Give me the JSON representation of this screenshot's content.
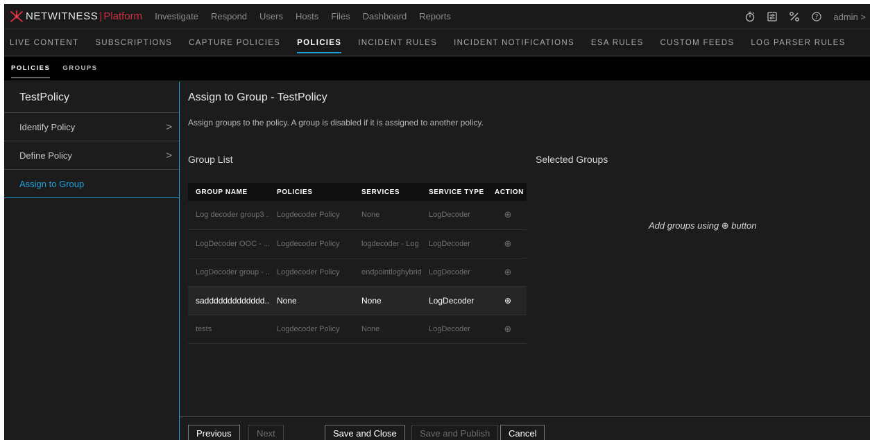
{
  "topnav": {
    "brand": "NETWITNESS",
    "brand_sep": "|",
    "platform": "Platform",
    "links": [
      "Investigate",
      "Respond",
      "Users",
      "Hosts",
      "Files",
      "Dashboard",
      "Reports"
    ],
    "icons": [
      "stopwatch-icon",
      "list-settings-icon",
      "tools-icon",
      "help-icon"
    ],
    "admin": "admin >"
  },
  "config_tabs": [
    "LIVE CONTENT",
    "SUBSCRIPTIONS",
    "CAPTURE POLICIES",
    "POLICIES",
    "INCIDENT RULES",
    "INCIDENT NOTIFICATIONS",
    "ESA RULES",
    "CUSTOM FEEDS",
    "LOG PARSER RULES"
  ],
  "config_active": "POLICIES",
  "sub_tabs": [
    "POLICIES",
    "GROUPS"
  ],
  "sub_active": "POLICIES",
  "left": {
    "title": "TestPolicy",
    "steps": [
      {
        "label": "Identify Policy",
        "chevron": ">"
      },
      {
        "label": "Define Policy",
        "chevron": ">"
      },
      {
        "label": "Assign to Group",
        "chevron": ""
      }
    ]
  },
  "main": {
    "heading": "Assign to Group - TestPolicy",
    "description": "Assign groups to the policy. A group is disabled if it is assigned to another policy.",
    "group_list_title": "Group List",
    "selected_title": "Selected Groups",
    "empty_message": "Add groups using ⊕ button",
    "table": {
      "columns": [
        "GROUP NAME",
        "POLICIES",
        "SERVICES",
        "SERVICE TYPE",
        "ACTION"
      ],
      "rows": [
        {
          "name": "Log decoder group3 ...",
          "policies": "Logdecoder Policy",
          "services": "None",
          "type": "LogDecoder",
          "action": "⊕",
          "enabled": false
        },
        {
          "name": "LogDecoder OOC - ...",
          "policies": "Logdecoder Policy",
          "services": "logdecoder - Log D",
          "type": "LogDecoder",
          "action": "⊕",
          "enabled": false
        },
        {
          "name": "LogDecoder group - ...",
          "policies": "Logdecoder Policy",
          "services": "endpointloghybrid",
          "type": "LogDecoder",
          "action": "⊕",
          "enabled": false
        },
        {
          "name": "saddddddddddddd...",
          "policies": "None",
          "services": "None",
          "type": "LogDecoder",
          "action": "⊕",
          "enabled": true
        },
        {
          "name": "tests",
          "policies": "Logdecoder Policy",
          "services": "None",
          "type": "LogDecoder",
          "action": "⊕",
          "enabled": false
        }
      ]
    }
  },
  "footer": {
    "previous": "Previous",
    "next": "Next",
    "save_close": "Save and Close",
    "save_publish": "Save and Publish",
    "cancel": "Cancel"
  },
  "colors": {
    "accent": "#1fa1db",
    "brand_red": "#c9303e",
    "background": "#1c1c1c"
  }
}
